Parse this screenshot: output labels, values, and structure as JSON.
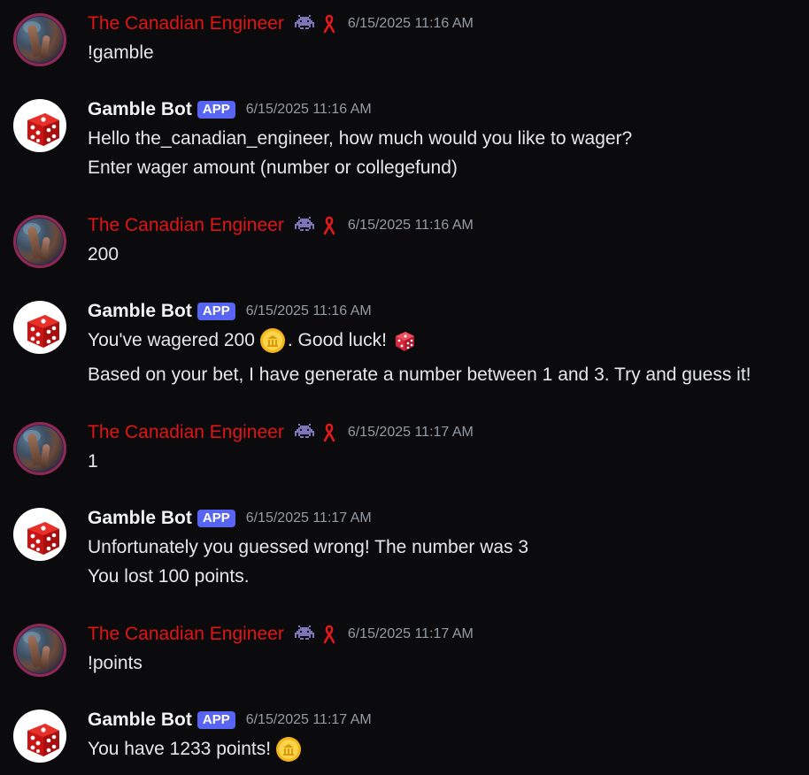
{
  "messages": [
    {
      "author": "The Canadian Engineer",
      "type": "user",
      "timestamp": "6/15/2025 11:16 AM",
      "lines": [
        "!gamble"
      ]
    },
    {
      "author": "Gamble Bot",
      "type": "bot",
      "badge": "APP",
      "timestamp": "6/15/2025 11:16 AM",
      "lines": [
        "Hello the_canadian_engineer, how much would you like to wager?",
        "Enter wager amount (number or collegefund)"
      ]
    },
    {
      "author": "The Canadian Engineer",
      "type": "user",
      "timestamp": "6/15/2025 11:16 AM",
      "lines": [
        "200"
      ]
    },
    {
      "author": "Gamble Bot",
      "type": "bot",
      "badge": "APP",
      "timestamp": "6/15/2025 11:16 AM",
      "line1_pre": "You've wagered 200",
      "line1_post": ". Good luck!",
      "lines": [
        "Based on your bet, I have generate a number between 1 and 3. Try and guess it!"
      ]
    },
    {
      "author": "The Canadian Engineer",
      "type": "user",
      "timestamp": "6/15/2025 11:17 AM",
      "lines": [
        "1"
      ]
    },
    {
      "author": "Gamble Bot",
      "type": "bot",
      "badge": "APP",
      "timestamp": "6/15/2025 11:17 AM",
      "lines": [
        "Unfortunately you guessed wrong! The number was 3",
        "You lost 100 points."
      ]
    },
    {
      "author": "The Canadian Engineer",
      "type": "user",
      "timestamp": "6/15/2025 11:17 AM",
      "lines": [
        "!points"
      ]
    },
    {
      "author": "Gamble Bot",
      "type": "bot",
      "badge": "APP",
      "timestamp": "6/15/2025 11:17 AM",
      "lines": [
        "You have 1233 points!"
      ]
    }
  ],
  "icons": {
    "user_avatar": "nebula-avatar-icon",
    "bot_avatar": "red-dice-avatar-icon",
    "role_icon": "space-invader-icon",
    "ribbon_icon": "awareness-ribbon-icon",
    "coin": "coin-emoji-icon",
    "die": "game-die-emoji-icon"
  },
  "colors": {
    "background": "#0b0b0e",
    "user_name": "#e11515",
    "bot_name": "#f2f3f5",
    "app_badge": "#5865f2",
    "timestamp": "#949ba4",
    "text": "#e6e7ea"
  }
}
